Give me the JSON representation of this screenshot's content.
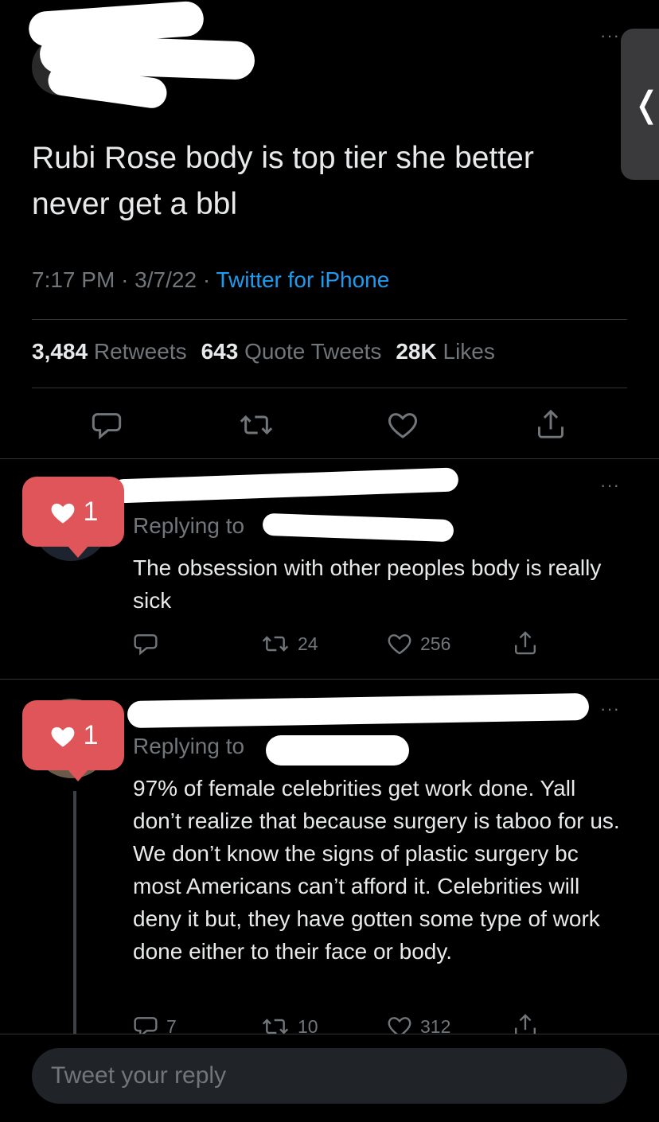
{
  "tweet": {
    "text": "Rubi Rose body is top tier she better never get a bbl",
    "time": "7:17 PM",
    "sep1": "·",
    "date": "3/7/22",
    "sep2": "·",
    "source": "Twitter for iPhone"
  },
  "stats": {
    "retweets_count": "3,484",
    "retweets_label": "Retweets",
    "quotes_count": "643",
    "quotes_label": "Quote Tweets",
    "likes_count": "28K",
    "likes_label": "Likes"
  },
  "replies": [
    {
      "badge_count": "1",
      "replying_label": "Replying to",
      "text": "The obsession with other peoples body is really sick",
      "retweets": "24",
      "likes": "256"
    },
    {
      "badge_count": "1",
      "replying_label": "Replying to",
      "text": "97% of female celebrities get work done. Yall don’t realize that because surgery is taboo for us. We don’t know the signs of plastic surgery bc most Americans can’t afford it. Celebrities will deny it but, they have gotten some type of work done either to their face or body.",
      "comments": "7",
      "retweets": "10",
      "likes": "312"
    }
  ],
  "composer": {
    "placeholder": "Tweet your reply"
  },
  "side_handle": {
    "glyph": "❬"
  },
  "more_glyph": "···",
  "colors": {
    "background": "#000000",
    "link": "#1d9bf0",
    "muted": "#71767b",
    "badge": "#e0555a"
  }
}
